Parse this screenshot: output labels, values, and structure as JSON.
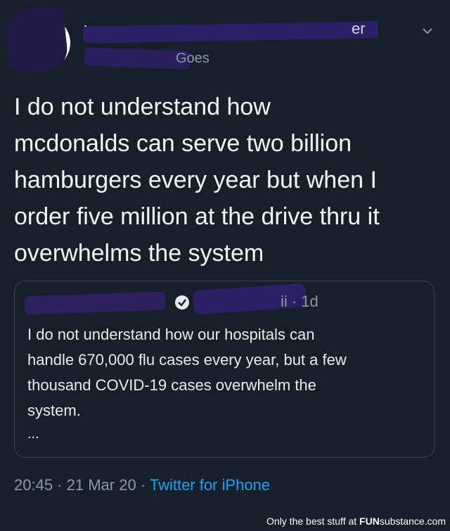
{
  "header": {
    "name_visible_lead": "I",
    "name_visible_tail": "er",
    "handle_visible_tail": "Goes"
  },
  "tweet": {
    "lines": [
      "I do not understand how",
      "mcdonalds can serve two billion",
      "hamburgers every year but when I",
      "order five million at the drive thru it",
      "overwhelms the system"
    ]
  },
  "quoted_tweet": {
    "meta": "ii · 1d",
    "lines": [
      "I do not understand how our hospitals can",
      "handle 670,000 flu cases every year, but a few",
      "thousand COVID-19 cases overwhelm the",
      "system."
    ],
    "more": "..."
  },
  "footer": {
    "time": "20:45",
    "separator": " · ",
    "date": "21 Mar 20",
    "source": "Twitter for iPhone"
  },
  "watermark": {
    "text": "Only the best stuff at ",
    "brand_bold": "FUN",
    "brand_rest": "substance.com"
  },
  "colors": {
    "background": "#15202b",
    "link": "#1da1f2",
    "secondary_text": "#8b98a5"
  },
  "icons": {
    "chevron": "chevron-down-icon",
    "verified": "verified-badge-icon"
  }
}
